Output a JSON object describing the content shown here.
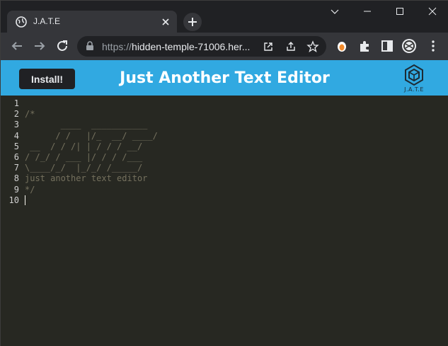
{
  "browser": {
    "tab": {
      "title": "J.A.T.E",
      "favicon": "globe-icon"
    },
    "new_tab_icon": "plus-icon",
    "window_controls": [
      "chevron-down-icon",
      "minimize-icon",
      "maximize-icon",
      "close-icon"
    ],
    "url": {
      "scheme": "https://",
      "host": "hidden-temple-71006.her..."
    },
    "toolbar_icons": [
      "back-icon",
      "forward-icon",
      "reload-icon",
      "lock-icon",
      "open-external-icon",
      "share-icon",
      "star-icon",
      "extension-orange-icon",
      "puzzle-icon",
      "sidebar-icon",
      "profile-avatar",
      "menu-icon"
    ]
  },
  "app": {
    "install_label": "Install!",
    "title": "Just Another Text Editor",
    "logo_text": "J.A.T.E",
    "header_color": "#31a9e1"
  },
  "editor": {
    "line_numbers": [
      "1",
      "2",
      "3",
      "4",
      "5",
      "6",
      "7",
      "8",
      "9",
      "10"
    ],
    "lines": [
      "",
      "/*",
      "       ____  ___________",
      "      / /   |/_  __/ ____/",
      " __  / / /| | / / / __/",
      "/ /_/ / ___ |/ / / /___",
      "\\____/_/  |_/_/ /_____/",
      "just another text editor",
      "*/",
      ""
    ],
    "background": "#272822",
    "comment_color": "#75715e"
  }
}
